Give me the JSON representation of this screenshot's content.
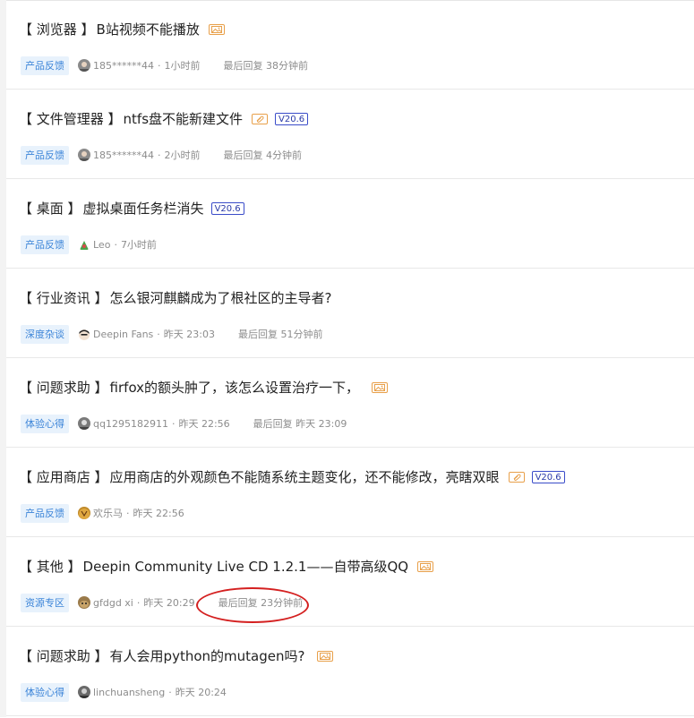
{
  "posts": [
    {
      "category": "【 浏览器 】",
      "title": "B站视频不能播放",
      "has_image": true,
      "has_attachment": false,
      "version": "",
      "tag": "产品反馈",
      "author": "185******44",
      "time": "1小时前",
      "last_reply": "最后回复 38分钟前",
      "avatar_color": "#8a8a8a"
    },
    {
      "category": "【 文件管理器 】",
      "title": "ntfs盘不能新建文件",
      "has_image": false,
      "has_attachment": true,
      "version": "V20.6",
      "tag": "产品反馈",
      "author": "185******44",
      "time": "2小时前",
      "last_reply": "最后回复 4分钟前",
      "avatar_color": "#8a8a8a"
    },
    {
      "category": "【 桌面 】",
      "title": "虚拟桌面任务栏消失",
      "has_image": false,
      "has_attachment": false,
      "version": "V20.6",
      "tag": "产品反馈",
      "author": "Leo",
      "time": "7小时前",
      "last_reply": "",
      "avatar_color": "#4aa34a"
    },
    {
      "category": "【 行业资讯 】",
      "title": "怎么银河麒麟成为了根社区的主导者?",
      "has_image": false,
      "has_attachment": false,
      "version": "",
      "tag": "深度杂谈",
      "author": "Deepin Fans",
      "time": "昨天 23:03",
      "last_reply": "最后回复 51分钟前",
      "avatar_color": "#333333"
    },
    {
      "category": "【 问题求助 】",
      "title": "firfox的额头肿了，该怎么设置治疗一下，",
      "has_image": true,
      "has_attachment": false,
      "version": "",
      "tag": "体验心得",
      "author": "qq1295182911",
      "time": "昨天 22:56",
      "last_reply": "最后回复 昨天 23:09",
      "avatar_color": "#7a7a7a"
    },
    {
      "category": "【 应用商店 】",
      "title": "应用商店的外观颜色不能随系统主题变化，还不能修改，亮瞎双眼",
      "has_image": false,
      "has_attachment": true,
      "version": "V20.6",
      "tag": "产品反馈",
      "author": "欢乐马",
      "time": "昨天 22:56",
      "last_reply": "",
      "avatar_color": "#c08a2a"
    },
    {
      "category": "【 其他 】",
      "title": "Deepin Community Live CD 1.2.1——自带高级QQ",
      "has_image": true,
      "has_attachment": false,
      "version": "",
      "tag": "资源专区",
      "author": "gfdgd xi",
      "time": "昨天 20:29",
      "last_reply": "最后回复 23分钟前",
      "avatar_color": "#9a7a4a"
    },
    {
      "category": "【 问题求助 】",
      "title": "有人会用python的mutagen吗?",
      "has_image": true,
      "has_attachment": false,
      "version": "",
      "tag": "体验心得",
      "author": "linchuansheng",
      "time": "昨天 20:24",
      "last_reply": "",
      "avatar_color": "#6a6a6a"
    }
  ],
  "colors": {
    "tag_bg": "#e8f2fc",
    "tag_text": "#3b84d8",
    "image_badge": "#e8a04a",
    "version_badge": "#3a4cc9",
    "highlight": "#d42020"
  }
}
